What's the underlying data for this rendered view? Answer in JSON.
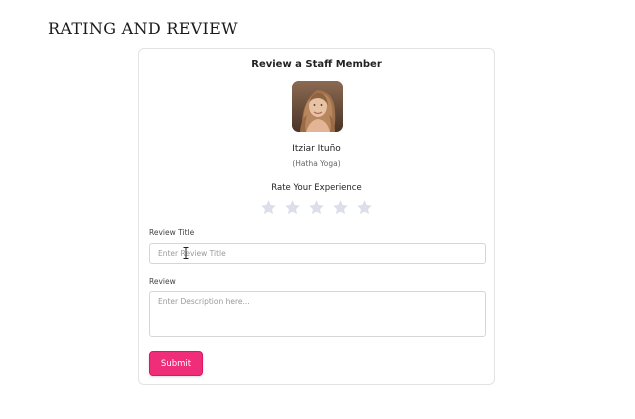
{
  "page": {
    "title": "RATING AND REVIEW"
  },
  "card": {
    "title": "Review a Staff Member",
    "staff": {
      "name": "Itziar Ituño",
      "class": "(Hatha Yoga)",
      "avatar_icon": "staff-photo"
    },
    "rating": {
      "label": "Rate Your Experience",
      "max": 5,
      "value": 0,
      "star_color": "#dcdfe9",
      "star_icon": "star-icon"
    },
    "review_title": {
      "label": "Review Title",
      "placeholder": "Enter Review Title",
      "value": ""
    },
    "review": {
      "label": "Review",
      "placeholder": "Enter Description here...",
      "value": ""
    },
    "submit_label": "Submit",
    "accent_color": "#ef2d78"
  }
}
